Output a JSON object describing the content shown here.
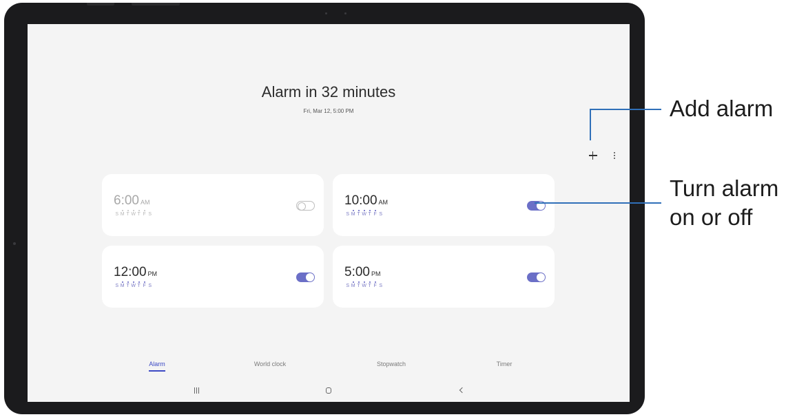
{
  "header": {
    "title": "Alarm in 32 minutes",
    "subtitle": "Fri, Mar 12, 5:00 PM"
  },
  "toolbar": {
    "add_icon": "plus-icon",
    "more_icon": "more-vertical-icon"
  },
  "alarms": [
    {
      "time": "6:00",
      "ampm": "AM",
      "days": [
        "S",
        "M",
        "T",
        "W",
        "T",
        "F",
        "S"
      ],
      "selected_days": [
        1,
        2,
        3,
        4,
        5
      ],
      "enabled": false
    },
    {
      "time": "10:00",
      "ampm": "AM",
      "days": [
        "S",
        "M",
        "T",
        "W",
        "T",
        "F",
        "S"
      ],
      "selected_days": [
        1,
        2,
        3,
        4,
        5
      ],
      "enabled": true
    },
    {
      "time": "12:00",
      "ampm": "PM",
      "days": [
        "S",
        "M",
        "T",
        "W",
        "T",
        "F",
        "S"
      ],
      "selected_days": [
        1,
        2,
        3,
        4,
        5
      ],
      "enabled": true
    },
    {
      "time": "5:00",
      "ampm": "PM",
      "days": [
        "S",
        "M",
        "T",
        "W",
        "T",
        "F",
        "S"
      ],
      "selected_days": [
        1,
        2,
        3,
        4,
        5
      ],
      "enabled": true
    }
  ],
  "tabs": [
    {
      "label": "Alarm",
      "active": true
    },
    {
      "label": "World clock",
      "active": false
    },
    {
      "label": "Stopwatch",
      "active": false
    },
    {
      "label": "Timer",
      "active": false
    }
  ],
  "nav": {
    "recent_icon": "recent-apps-icon",
    "home_icon": "home-icon",
    "back_icon": "back-icon"
  },
  "callouts": {
    "add_alarm": "Add alarm",
    "toggle_line1": "Turn alarm",
    "toggle_line2": "on or off"
  },
  "colors": {
    "accent": "#3c49c4",
    "toggle_on": "#6b6fc7",
    "callout_line": "#2f6fb8"
  }
}
